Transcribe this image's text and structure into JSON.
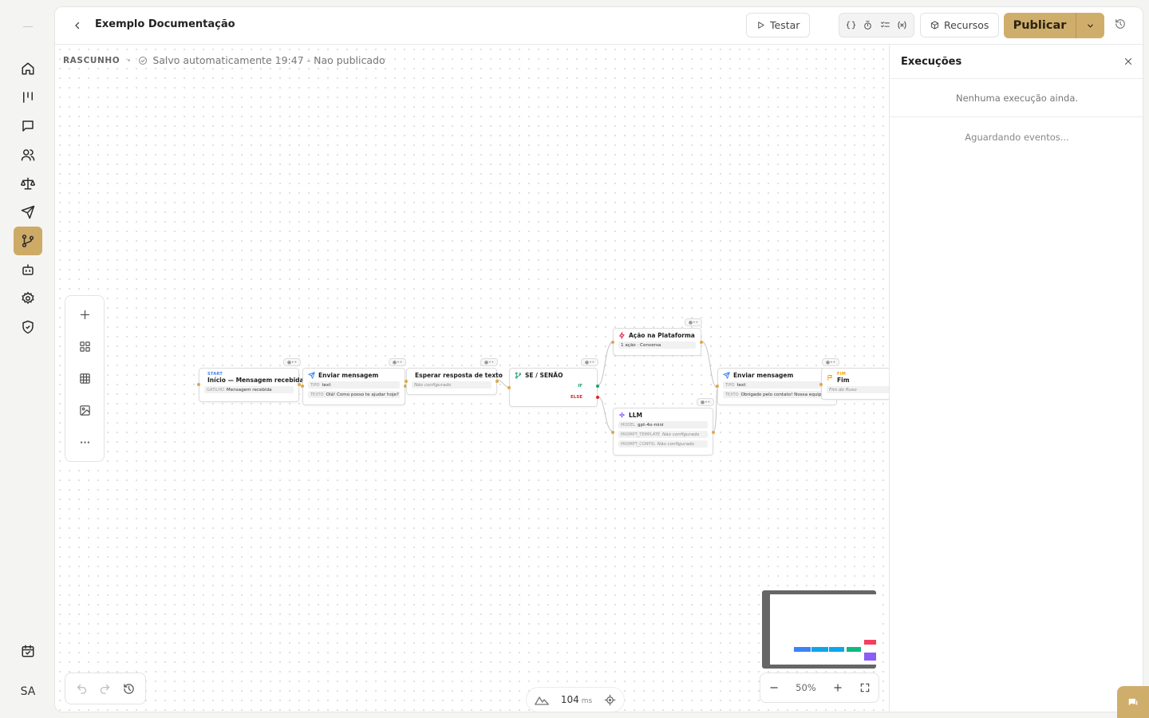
{
  "rail": {
    "avatar": "SA",
    "items": [
      {
        "icon": "home-icon",
        "active": false
      },
      {
        "icon": "pipeline-icon",
        "active": false
      },
      {
        "icon": "chat-icon",
        "active": false
      },
      {
        "icon": "users-icon",
        "active": false
      },
      {
        "icon": "scale-icon",
        "active": false
      },
      {
        "icon": "send-icon",
        "active": false
      },
      {
        "icon": "flow-branch-icon",
        "active": true
      },
      {
        "icon": "bot-icon",
        "active": false
      },
      {
        "icon": "gear-icon",
        "active": false
      },
      {
        "icon": "shield-check-icon",
        "active": false
      },
      {
        "icon": "calendar-check-icon",
        "active": false
      }
    ],
    "accent": "#cdaa66"
  },
  "header": {
    "title": "Exemplo Documentação",
    "test_label": "Testar",
    "resources_label": "Recursos",
    "publish_label": "Publicar",
    "publish_color": "#cfae6c"
  },
  "status": {
    "draft_label": "RASCUNHO",
    "saved_text": "Salvo automaticamente 19:47 - Nao publicado"
  },
  "flow": {
    "nodes": {
      "start": {
        "kicker": "START",
        "title": "Início — Mensagem recebida",
        "field_key": "GATILHO",
        "field_value": "Mensagem recebida"
      },
      "send1": {
        "title": "Enviar mensagem",
        "type_key": "TIPO",
        "type_value": "text",
        "text_key": "TEXTO",
        "text_value": "Olá! Como posso te ajudar hoje?"
      },
      "wait": {
        "title": "Esperar resposta de texto",
        "placeholder": "Não configurado"
      },
      "if": {
        "title": "SE / SENÃO",
        "if_label": "IF",
        "else_label": "ELSE"
      },
      "action": {
        "title": "Ação na Plataforma",
        "field_value": "1 ação · Conversa"
      },
      "llm": {
        "title": "LLM",
        "model_key": "MODEL",
        "model_value": "gpt-4o-mini",
        "prompt_key": "PROMPT_TEMPLATE",
        "prompt_value": "Não configurado",
        "config_key": "PROMPT_CONFIG",
        "config_value": "Não configurado"
      },
      "send2": {
        "title": "Enviar mensagem",
        "type_key": "TIPO",
        "type_value": "text",
        "text_key": "TEXTO",
        "text_value": "Obrigado pelo contato! Nossa equipe"
      },
      "end": {
        "kicker": "FIM",
        "title": "Fim",
        "field_value": "Fim do fluxo"
      }
    }
  },
  "latency": {
    "value": "104",
    "unit": "ms"
  },
  "zoom": {
    "level": "50%"
  },
  "side_panel": {
    "title": "Execuções",
    "empty_text": "Nenhuma execução ainda.",
    "waiting_text": "Aguardando eventos..."
  }
}
